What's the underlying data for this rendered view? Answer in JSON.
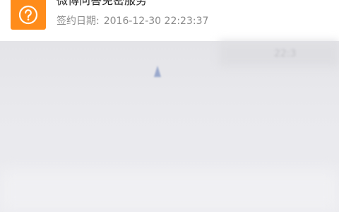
{
  "contract": {
    "icon": "question-mark-icon",
    "accent_color": "#ff8c1a",
    "service_name": "微博问答免密服务",
    "date_label": "签约日期:",
    "date_value": "2016-12-30 22:23:37"
  },
  "blurred": {
    "partial_time": "22:3"
  }
}
